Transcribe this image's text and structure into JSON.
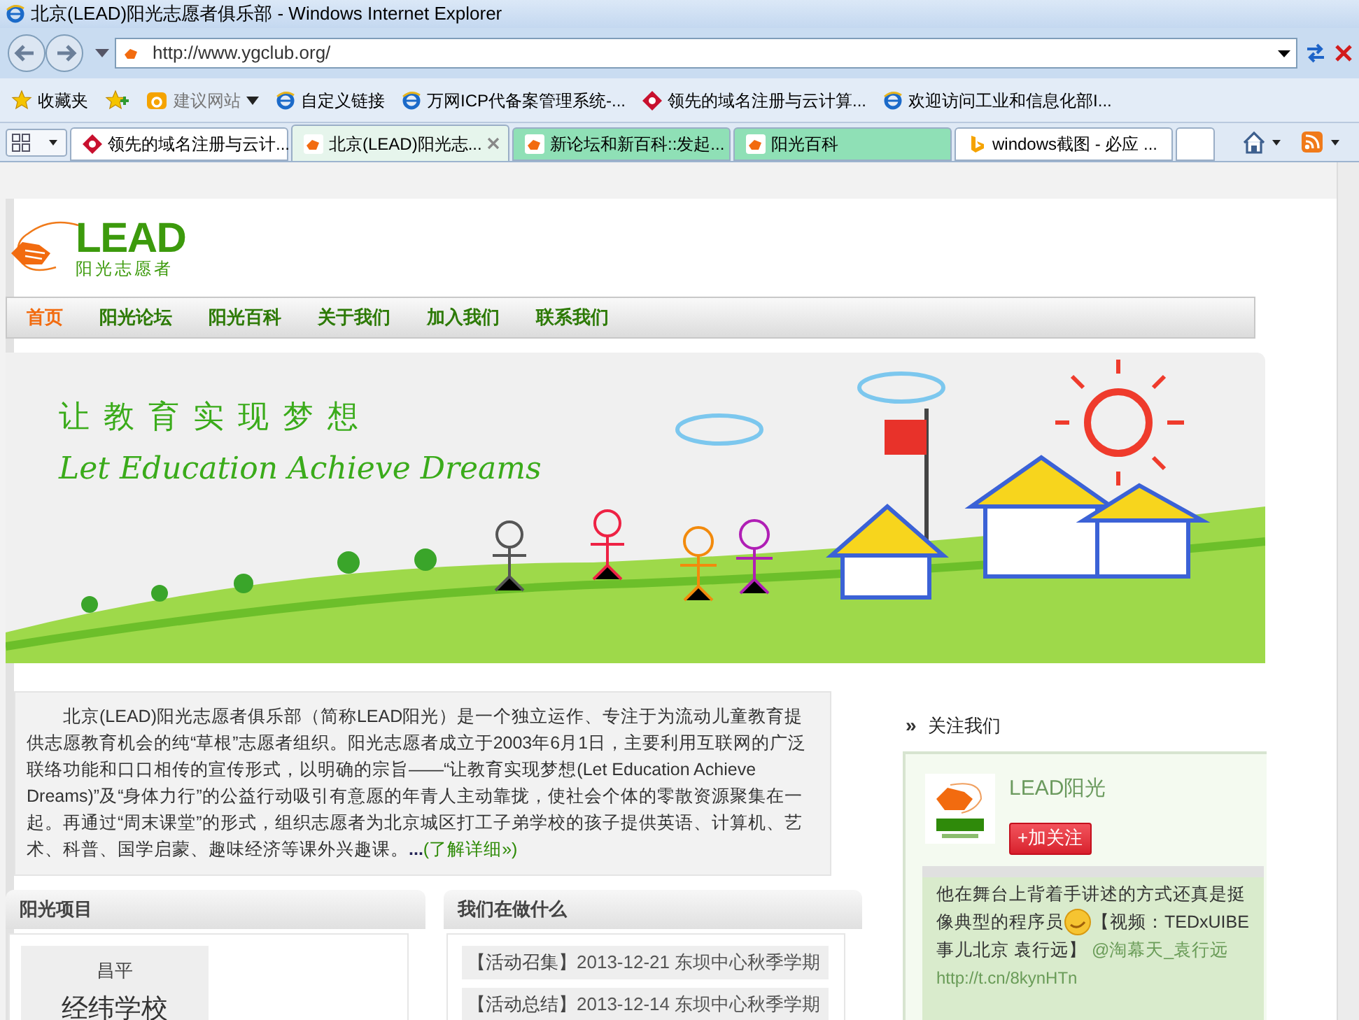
{
  "window": {
    "title": "北京(LEAD)阳光志愿者俱乐部 - Windows Internet Explorer"
  },
  "address_bar": {
    "url": "http://www.ygclub.org/"
  },
  "favorites_bar": {
    "label": "收藏夹",
    "items": [
      {
        "label": "建议网站",
        "kind": "suggest",
        "dropdown": true
      },
      {
        "label": "自定义链接",
        "kind": "ie",
        "dropdown": false
      },
      {
        "label": "万网ICP代备案管理系统-...",
        "kind": "ie",
        "dropdown": false
      },
      {
        "label": "领先的域名注册与云计算...",
        "kind": "net",
        "dropdown": false
      },
      {
        "label": "欢迎访问工业和信息化部I...",
        "kind": "ie",
        "dropdown": false
      }
    ]
  },
  "tabs": [
    {
      "label": "领先的域名注册与云计...",
      "kind": "net",
      "selected": false,
      "color": "#ffffff"
    },
    {
      "label": "北京(LEAD)阳光志...",
      "kind": "lead",
      "selected": true,
      "color": "#e6f5ec"
    },
    {
      "label": "新论坛和新百科::发起...",
      "kind": "lead",
      "selected": false,
      "color": "#8fe0b6"
    },
    {
      "label": "阳光百科",
      "kind": "lead",
      "selected": false,
      "color": "#8fe0b6"
    },
    {
      "label": "windows截图 - 必应 ...",
      "kind": "bing",
      "selected": false,
      "color": "#ffffff"
    }
  ],
  "page": {
    "logo": {
      "name": "LEAD",
      "tagline": "阳光志愿者"
    },
    "nav": [
      {
        "label": "首页",
        "selected": true
      },
      {
        "label": "阳光论坛",
        "selected": false
      },
      {
        "label": "阳光百科",
        "selected": false
      },
      {
        "label": "关于我们",
        "selected": false
      },
      {
        "label": "加入我们",
        "selected": false
      },
      {
        "label": "联系我们",
        "selected": false
      }
    ],
    "banner": {
      "slogan": "让教育实现梦想",
      "slogan_en": "Let Education Achieve Dreams"
    },
    "intro": {
      "text": "北京(LEAD)阳光志愿者俱乐部（简称LEAD阳光）是一个独立运作、专注于为流动儿童教育提供志愿教育机会的纯“草根”志愿者组织。阳光志愿者成立于2003年6月1日，主要利用互联网的广泛联络功能和口口相传的宣传形式，以明确的宗旨——“让教育实现梦想(Let Education Achieve Dreams)”及“身体力行”的公益行动吸引有意愿的年青人主动靠拢，使社会个体的零散资源聚集在一起。再通过“周末课堂”的形式，组织志愿者为北京城区打工子弟学校的孩子提供英语、计算机、艺术、科普、国学启蒙、趣味经济等课外兴趣课。",
      "ellipsis": "...",
      "more_link": "(了解详细»)"
    },
    "follow": {
      "heading_mark": "»",
      "heading": "关注我们",
      "account": "LEAD阳光",
      "follow_button": "+加关注",
      "tweet": {
        "text": "他在舞台上背着手讲述的方式还真是挺像典型的程序员",
        "topic": "【视频：TEDxUIBE 事儿北京  袁行远】",
        "mention": "@淘幕天_袁行远",
        "link": "http://t.cn/8kynHTn"
      }
    },
    "projects": {
      "title": "阳光项目",
      "items": [
        {
          "area": "昌平",
          "school": "经纬学校"
        }
      ]
    },
    "activities": {
      "title": "我们在做什么",
      "items": [
        {
          "tag": "【活动召集】",
          "text": "2013-12-21 东坝中心秋季学期"
        },
        {
          "tag": "【活动总结】",
          "text": "2013-12-14 东坝中心秋季学期"
        }
      ]
    }
  }
}
